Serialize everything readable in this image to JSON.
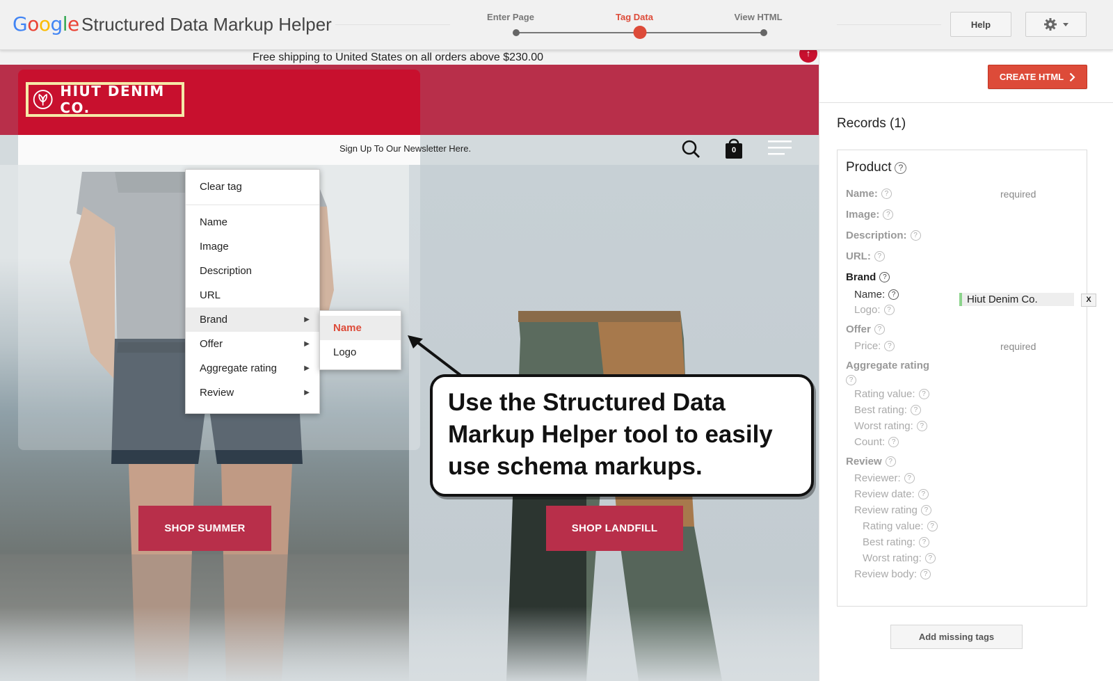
{
  "header": {
    "logo_letters": [
      {
        "ch": "G",
        "color": "#4285F4"
      },
      {
        "ch": "o",
        "color": "#EA4335"
      },
      {
        "ch": "o",
        "color": "#FBBC05"
      },
      {
        "ch": "g",
        "color": "#4285F4"
      },
      {
        "ch": "l",
        "color": "#34A853"
      },
      {
        "ch": "e",
        "color": "#EA4335"
      }
    ],
    "title": "Structured Data Markup Helper",
    "help_label": "Help",
    "settings_icon": "gear-icon",
    "settings_dropdown_icon": "caret-down-icon"
  },
  "stepper": {
    "steps": [
      {
        "label": "Enter Page",
        "active": false
      },
      {
        "label": "Tag Data",
        "active": true
      },
      {
        "label": "View HTML",
        "active": false
      }
    ],
    "active_color": "#dd4b39"
  },
  "preview": {
    "shipping_text": "Free shipping to United States on all orders above $230.00",
    "brand_name": "HIUT DENIM CO.",
    "brand_logo_icon": "leaf-emblem-icon",
    "cart_count": "0",
    "newsletter_text": "Sign Up To Our Newsletter Here.",
    "shop_summer_label": "SHOP SUMMER",
    "shop_landfill_label": "SHOP LANDFILL",
    "brand_color": "#b82f4a",
    "highlight_color": "#c8102e"
  },
  "context_menu": {
    "clear_label": "Clear tag",
    "items": [
      {
        "label": "Name",
        "has_sub": false
      },
      {
        "label": "Image",
        "has_sub": false
      },
      {
        "label": "Description",
        "has_sub": false
      },
      {
        "label": "URL",
        "has_sub": false
      },
      {
        "label": "Brand",
        "has_sub": true,
        "highlighted": true
      },
      {
        "label": "Offer",
        "has_sub": true
      },
      {
        "label": "Aggregate rating",
        "has_sub": true
      },
      {
        "label": "Review",
        "has_sub": true
      }
    ],
    "submenu": [
      {
        "label": "Name",
        "highlighted": true
      },
      {
        "label": "Logo",
        "highlighted": false
      }
    ]
  },
  "callout": {
    "text": "Use the Structured Data Markup Helper tool to easily use schema markups."
  },
  "sidebar": {
    "create_html_label": "CREATE HTML",
    "records_title": "Records (1)",
    "record": {
      "type": "Product",
      "fields": [
        {
          "label": "Name:",
          "level": 0,
          "required": "required"
        },
        {
          "label": "Image:",
          "level": 0
        },
        {
          "label": "Description:",
          "level": 0
        },
        {
          "label": "URL:",
          "level": 0
        },
        {
          "label": "Brand",
          "level": 0,
          "dark": true
        },
        {
          "label": "Name:",
          "level": 1,
          "dark": true,
          "value": "Hiut Denim Co."
        },
        {
          "label": "Logo:",
          "level": 1
        },
        {
          "label": "Offer",
          "level": 0
        },
        {
          "label": "Price:",
          "level": 1,
          "required": "required"
        },
        {
          "label": "Aggregate rating",
          "level": 0
        },
        {
          "label": "Rating value:",
          "level": 1
        },
        {
          "label": "Best rating:",
          "level": 1
        },
        {
          "label": "Worst rating:",
          "level": 1
        },
        {
          "label": "Count:",
          "level": 1
        },
        {
          "label": "Review",
          "level": 0
        },
        {
          "label": "Reviewer:",
          "level": 1
        },
        {
          "label": "Review date:",
          "level": 1
        },
        {
          "label": "Review rating",
          "level": 1
        },
        {
          "label": "Rating value:",
          "level": 2
        },
        {
          "label": "Best rating:",
          "level": 2
        },
        {
          "label": "Worst rating:",
          "level": 2
        },
        {
          "label": "Review body:",
          "level": 1
        }
      ],
      "remove_label": "X"
    },
    "add_missing_label": "Add missing tags"
  }
}
